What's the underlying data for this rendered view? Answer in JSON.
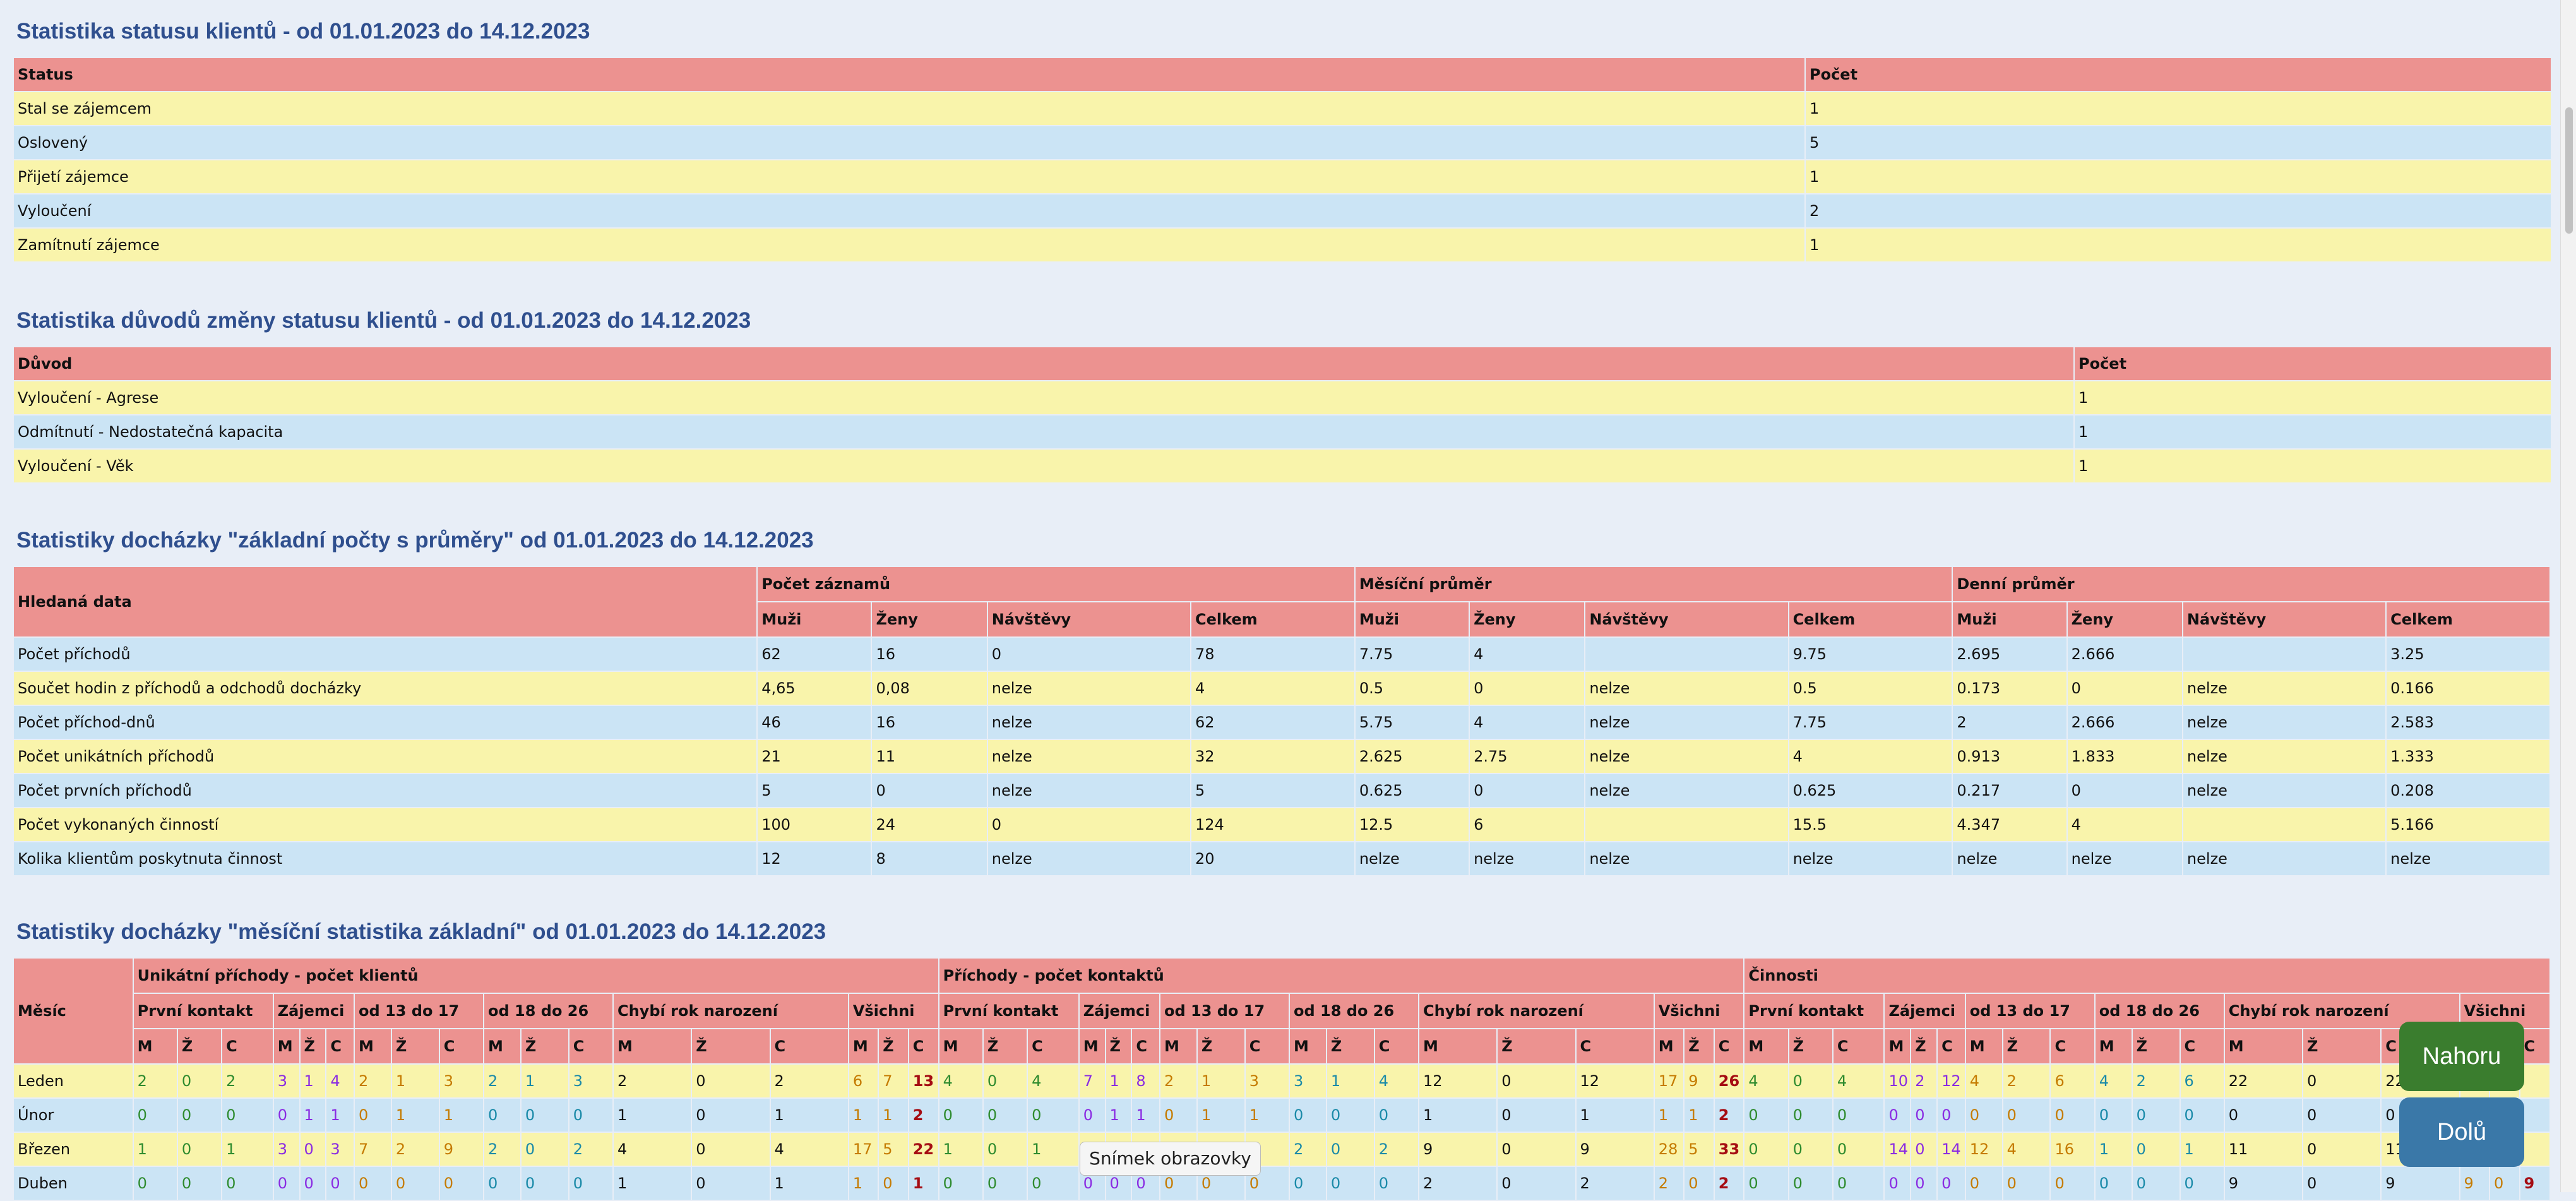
{
  "status_section": {
    "title": "Statistika statusu klientů - od 01.01.2023 do 14.12.2023",
    "headers": [
      "Status",
      "Počet"
    ],
    "rows": [
      [
        "Stal se zájemcem",
        "1"
      ],
      [
        "Oslovený",
        "5"
      ],
      [
        "Přijetí zájemce",
        "1"
      ],
      [
        "Vyloučení",
        "2"
      ],
      [
        "Zamítnutí zájemce",
        "1"
      ]
    ]
  },
  "reason_section": {
    "title": "Statistika důvodů změny statusu klientů - od 01.01.2023 do 14.12.2023",
    "headers": [
      "Důvod",
      "Počet"
    ],
    "rows": [
      [
        "Vyloučení - Agrese",
        "1"
      ],
      [
        "Odmítnutí - Nedostatečná kapacita",
        "1"
      ],
      [
        "Vyloučení - Věk",
        "1"
      ]
    ]
  },
  "attendance_section": {
    "title": "Statistiky docházky \"základní počty s průměry\" od 01.01.2023 do 14.12.2023",
    "row_header": "Hledaná data",
    "groups": [
      "Počet záznamů",
      "Měsíční průměr",
      "Denní průměr"
    ],
    "subheaders": [
      "Muži",
      "Ženy",
      "Návštěvy",
      "Celkem"
    ],
    "rows": [
      [
        "Počet příchodů",
        "62",
        "16",
        "0",
        "78",
        "7.75",
        "4",
        "",
        "9.75",
        "2.695",
        "2.666",
        "",
        "3.25"
      ],
      [
        "Součet hodin z příchodů a odchodů docházky",
        "4,65",
        "0,08",
        "nelze",
        "4",
        "0.5",
        "0",
        "nelze",
        "0.5",
        "0.173",
        "0",
        "nelze",
        "0.166"
      ],
      [
        "Počet příchod-dnů",
        "46",
        "16",
        "nelze",
        "62",
        "5.75",
        "4",
        "nelze",
        "7.75",
        "2",
        "2.666",
        "nelze",
        "2.583"
      ],
      [
        "Počet unikátních příchodů",
        "21",
        "11",
        "nelze",
        "32",
        "2.625",
        "2.75",
        "nelze",
        "4",
        "0.913",
        "1.833",
        "nelze",
        "1.333"
      ],
      [
        "Počet prvních příchodů",
        "5",
        "0",
        "nelze",
        "5",
        "0.625",
        "0",
        "nelze",
        "0.625",
        "0.217",
        "0",
        "nelze",
        "0.208"
      ],
      [
        "Počet vykonaných činností",
        "100",
        "24",
        "0",
        "124",
        "12.5",
        "6",
        "",
        "15.5",
        "4.347",
        "4",
        "",
        "5.166"
      ],
      [
        "Kolika klientům poskytnuta činnost",
        "12",
        "8",
        "nelze",
        "20",
        "nelze",
        "nelze",
        "nelze",
        "nelze",
        "nelze",
        "nelze",
        "nelze",
        "nelze"
      ]
    ]
  },
  "monthly_section": {
    "title": "Statistiky docházky \"měsíční statistika základní\" od 01.01.2023 do 14.12.2023",
    "month_header": "Měsíc",
    "groups": [
      "Unikátní příchody - počet klientů",
      "Příchody - počet kontaktů",
      "Činnosti"
    ],
    "subgroups": [
      "První kontakt",
      "Zájemci",
      "od 13 do 17",
      "od 18 do 26",
      "Chybí rok narození",
      "Všichni"
    ],
    "mzc": [
      "M",
      "Ž",
      "C"
    ],
    "rows": [
      {
        "month": "Leden",
        "cells": [
          "2",
          "0",
          "2",
          "3",
          "1",
          "4",
          "2",
          "1",
          "3",
          "2",
          "1",
          "3",
          "2",
          "0",
          "2",
          "6",
          "7",
          "13",
          "4",
          "0",
          "4",
          "7",
          "1",
          "8",
          "2",
          "1",
          "3",
          "3",
          "1",
          "4",
          "12",
          "0",
          "12",
          "17",
          "9",
          "26",
          "4",
          "0",
          "4",
          "10",
          "2",
          "12",
          "4",
          "2",
          "6",
          "4",
          "2",
          "6",
          "22",
          "0",
          "22",
          "",
          "",
          ""
        ]
      },
      {
        "month": "Únor",
        "cells": [
          "0",
          "0",
          "0",
          "0",
          "1",
          "1",
          "0",
          "1",
          "1",
          "0",
          "0",
          "0",
          "1",
          "0",
          "1",
          "1",
          "1",
          "2",
          "0",
          "0",
          "0",
          "0",
          "1",
          "1",
          "0",
          "1",
          "1",
          "0",
          "0",
          "0",
          "1",
          "0",
          "1",
          "1",
          "1",
          "2",
          "0",
          "0",
          "0",
          "0",
          "0",
          "0",
          "0",
          "0",
          "0",
          "0",
          "0",
          "0",
          "0",
          "0",
          "0",
          "",
          "",
          ""
        ]
      },
      {
        "month": "Březen",
        "cells": [
          "1",
          "0",
          "1",
          "3",
          "0",
          "3",
          "7",
          "2",
          "9",
          "2",
          "0",
          "2",
          "4",
          "0",
          "4",
          "17",
          "5",
          "22",
          "1",
          "0",
          "1",
          "7",
          "",
          "",
          "",
          "",
          "",
          "2",
          "0",
          "2",
          "9",
          "0",
          "9",
          "28",
          "5",
          "33",
          "0",
          "0",
          "0",
          "14",
          "0",
          "14",
          "12",
          "4",
          "16",
          "1",
          "0",
          "1",
          "11",
          "0",
          "11",
          "",
          "",
          ""
        ]
      },
      {
        "month": "Duben",
        "cells": [
          "0",
          "0",
          "0",
          "0",
          "0",
          "0",
          "0",
          "0",
          "0",
          "0",
          "0",
          "0",
          "1",
          "0",
          "1",
          "1",
          "0",
          "1",
          "0",
          "0",
          "0",
          "0",
          "0",
          "0",
          "0",
          "0",
          "0",
          "0",
          "0",
          "0",
          "2",
          "0",
          "2",
          "2",
          "0",
          "2",
          "0",
          "0",
          "0",
          "0",
          "0",
          "0",
          "0",
          "0",
          "0",
          "0",
          "0",
          "0",
          "9",
          "0",
          "9",
          "9",
          "0",
          "9"
        ]
      }
    ]
  },
  "buttons": {
    "up": "Nahoru",
    "down": "Dolů"
  },
  "tooltip": "Snímek obrazovky"
}
